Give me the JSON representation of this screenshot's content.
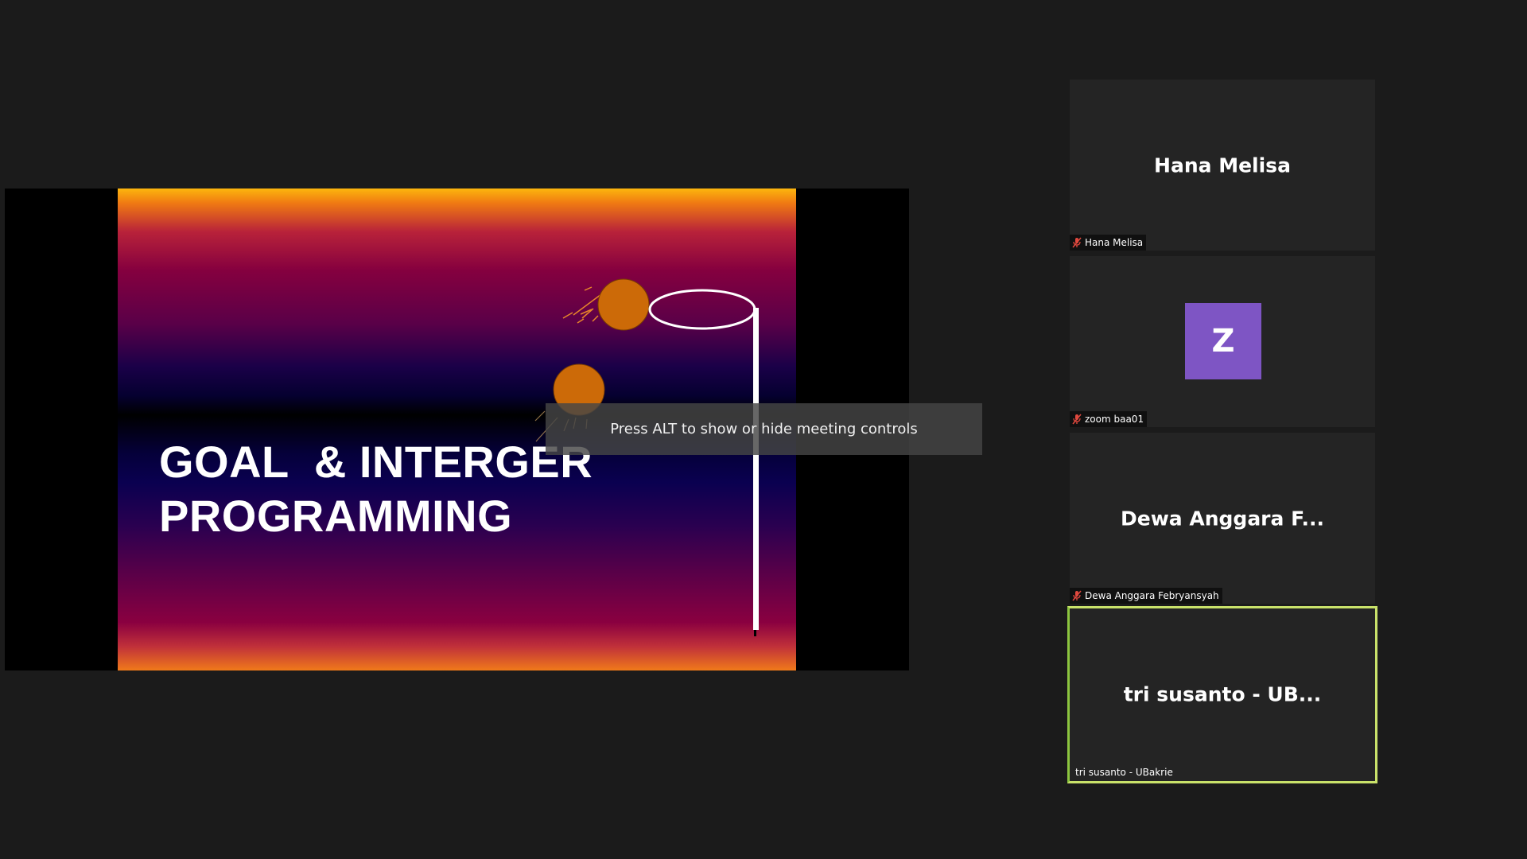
{
  "share": {
    "slide": {
      "title_line1": "GOAL  & INTERGER",
      "title_line2": "PROGRAMMING"
    },
    "tooltip": "Press ALT to show or hide meeting controls"
  },
  "participants": [
    {
      "display": "Hana Melisa",
      "tag": "Hana Melisa",
      "muted": true,
      "icon": "mic-muted-icon"
    },
    {
      "display": "Z",
      "tag": "zoom baa01",
      "muted": true,
      "avatar_color": "#7e55c4",
      "icon": "mic-muted-icon"
    },
    {
      "display": "Dewa Anggara F...",
      "tag": "Dewa Anggara Febryansyah",
      "muted": true,
      "icon": "mic-muted-icon"
    },
    {
      "display": "tri susanto - UB...",
      "tag": "tri susanto - UBakrie",
      "muted": false,
      "active_speaker": true,
      "highlight_color": "#c9e26a"
    }
  ],
  "colors": {
    "background": "#1b1b1b",
    "tile": "#242424",
    "muted_icon": "#e0483e"
  }
}
